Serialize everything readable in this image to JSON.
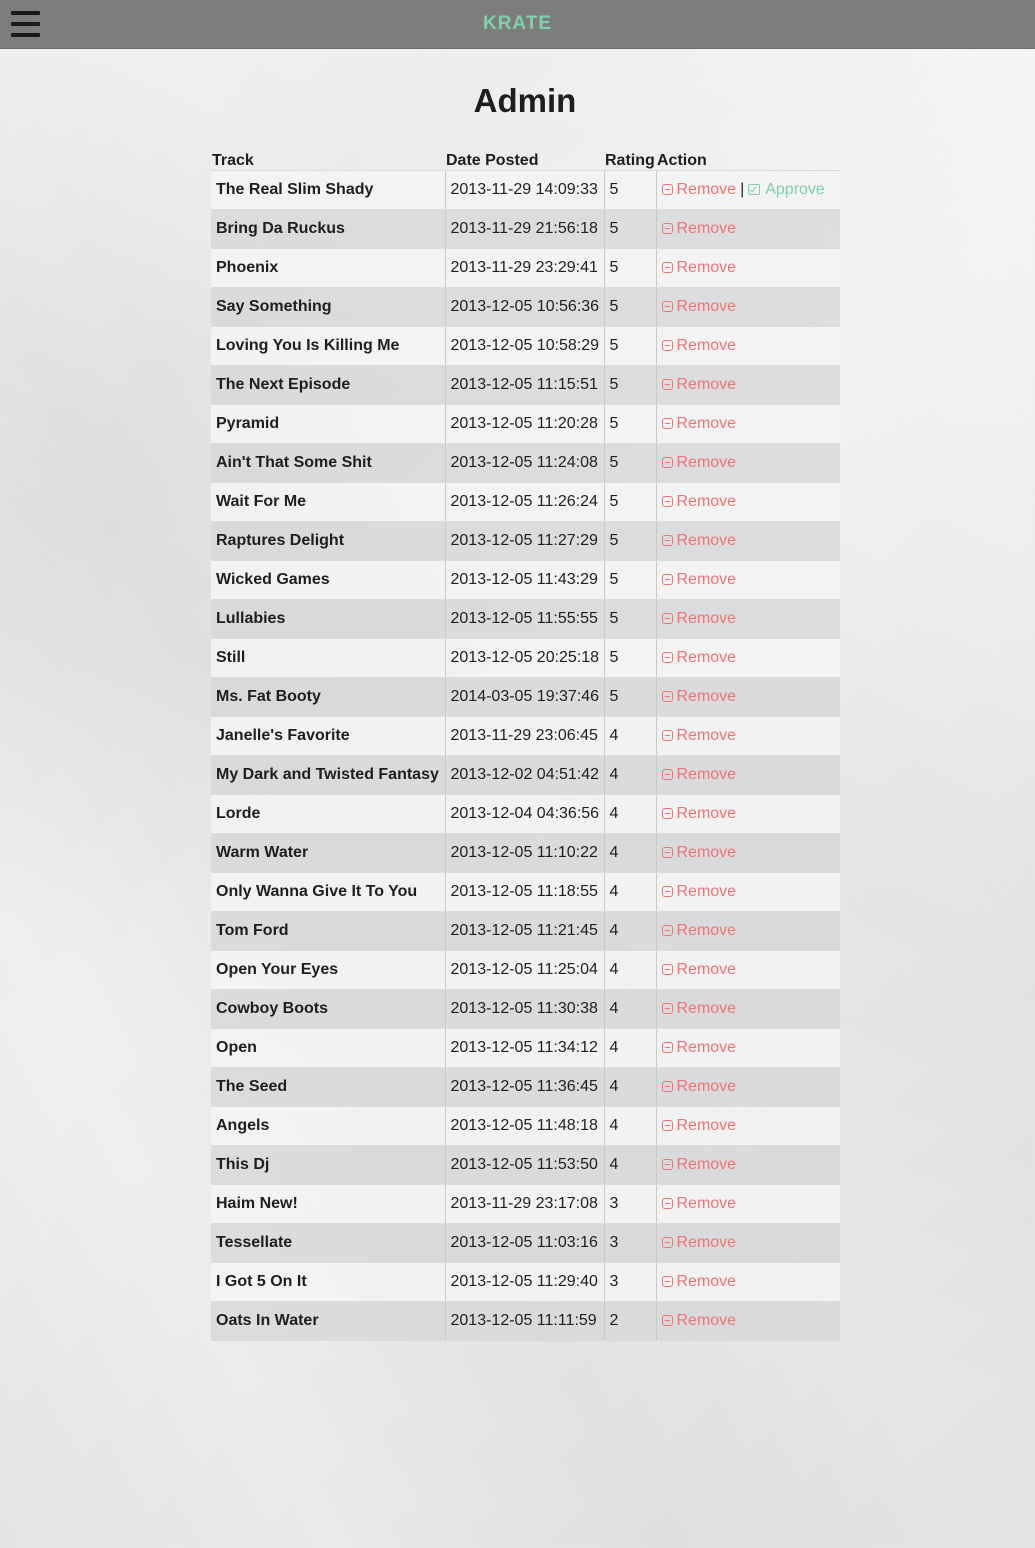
{
  "app": {
    "brand": "KRATE",
    "menu_icon": "hamburger-menu-icon"
  },
  "page": {
    "title": "Admin"
  },
  "colors": {
    "brand": "#7fd1aa",
    "remove": "#f07474",
    "approve": "#7fcfa6",
    "navbar": "#7d7d7d"
  },
  "table": {
    "headers": {
      "track": "Track",
      "date": "Date Posted",
      "rating": "Rating",
      "action": "Action"
    },
    "remove_label": "Remove",
    "approve_label": "Approve",
    "separator": "|",
    "rows": [
      {
        "track": "The Real Slim Shady",
        "date": "2013-11-29 14:09:33",
        "rating": "5",
        "approve": true
      },
      {
        "track": "Bring Da Ruckus",
        "date": "2013-11-29 21:56:18",
        "rating": "5"
      },
      {
        "track": "Phoenix",
        "date": "2013-11-29 23:29:41",
        "rating": "5"
      },
      {
        "track": "Say Something",
        "date": "2013-12-05 10:56:36",
        "rating": "5"
      },
      {
        "track": "Loving You Is Killing Me",
        "date": "2013-12-05 10:58:29",
        "rating": "5"
      },
      {
        "track": "The Next Episode",
        "date": "2013-12-05 11:15:51",
        "rating": "5"
      },
      {
        "track": "Pyramid",
        "date": "2013-12-05 11:20:28",
        "rating": "5"
      },
      {
        "track": "Ain't That Some Shit",
        "date": "2013-12-05 11:24:08",
        "rating": "5"
      },
      {
        "track": "Wait For Me",
        "date": "2013-12-05 11:26:24",
        "rating": "5"
      },
      {
        "track": "Raptures Delight",
        "date": "2013-12-05 11:27:29",
        "rating": "5"
      },
      {
        "track": "Wicked Games",
        "date": "2013-12-05 11:43:29",
        "rating": "5"
      },
      {
        "track": "Lullabies",
        "date": "2013-12-05 11:55:55",
        "rating": "5"
      },
      {
        "track": "Still",
        "date": "2013-12-05 20:25:18",
        "rating": "5"
      },
      {
        "track": "Ms. Fat Booty",
        "date": "2014-03-05 19:37:46",
        "rating": "5"
      },
      {
        "track": "Janelle's Favorite",
        "date": "2013-11-29 23:06:45",
        "rating": "4"
      },
      {
        "track": "My Dark and Twisted Fantasy",
        "date": "2013-12-02 04:51:42",
        "rating": "4"
      },
      {
        "track": "Lorde",
        "date": "2013-12-04 04:36:56",
        "rating": "4"
      },
      {
        "track": "Warm Water",
        "date": "2013-12-05 11:10:22",
        "rating": "4"
      },
      {
        "track": "Only Wanna Give It To You",
        "date": "2013-12-05 11:18:55",
        "rating": "4"
      },
      {
        "track": "Tom Ford",
        "date": "2013-12-05 11:21:45",
        "rating": "4"
      },
      {
        "track": "Open Your Eyes",
        "date": "2013-12-05 11:25:04",
        "rating": "4"
      },
      {
        "track": "Cowboy Boots",
        "date": "2013-12-05 11:30:38",
        "rating": "4"
      },
      {
        "track": "Open",
        "date": "2013-12-05 11:34:12",
        "rating": "4"
      },
      {
        "track": "The Seed",
        "date": "2013-12-05 11:36:45",
        "rating": "4"
      },
      {
        "track": "Angels",
        "date": "2013-12-05 11:48:18",
        "rating": "4"
      },
      {
        "track": "This Dj",
        "date": "2013-12-05 11:53:50",
        "rating": "4"
      },
      {
        "track": "Haim New!",
        "date": "2013-11-29 23:17:08",
        "rating": "3"
      },
      {
        "track": "Tessellate",
        "date": "2013-12-05 11:03:16",
        "rating": "3"
      },
      {
        "track": "I Got 5 On It",
        "date": "2013-12-05 11:29:40",
        "rating": "3"
      },
      {
        "track": "Oats In Water",
        "date": "2013-12-05 11:11:59",
        "rating": "2"
      }
    ]
  }
}
